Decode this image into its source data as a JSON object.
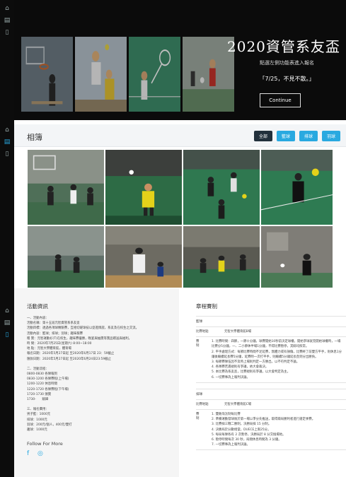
{
  "hero": {
    "title": "2020資管系友盃",
    "subtitle": "點選左側功能表進入報名",
    "date_text": "「7/25，不見不散。」",
    "continue_label": "Continue"
  },
  "gallery": {
    "title": "相簿",
    "filters": [
      {
        "label": "全部",
        "dark": true
      },
      {
        "label": "籃球",
        "dark": false
      },
      {
        "label": "排球",
        "dark": false
      },
      {
        "label": "羽球",
        "dark": false
      }
    ]
  },
  "info": {
    "heading": "活動資訊",
    "section1": [
      "一、活動內容：",
      "活動名稱：第十五屆元智資管系系友盃",
      "活動目標：透過各項球類競賽，互相切磋球技以促進情誼，系友及在校生之交流。",
      "活動內容：籃球；排球；羽球；趣味競賽",
      "贈 獎：元智運動衫(T)在校生，趣味賽優勝，晚宴與抽獎等獎品贈送與福利。",
      "時 間：2020年7月25日(星期六) 8:00~18:00",
      "地 點：元智大學體育館，體育場",
      "報名日期：2020年5月27日起 至2020年6月17日 23：59截止",
      "匯款日期：2020年5月27日起 至2020年6月24日23:59截止"
    ],
    "section2": [
      "二、活動流程：",
      "0800-0830 各隊報到",
      "0830-1200 各隊賽程(上午場)",
      "1200-1220 休息時間",
      "1220-1720 各隊賽程(下午場)",
      "1720-1730 頒獎",
      "1730-　　賦歸"
    ],
    "section3": [
      "三、報名費用：",
      "男子籃：1000元",
      "排球：1000元",
      "羽球：200元/個人，400元/雙打",
      "趣球：1000元"
    ],
    "follow_label": "Follow For More"
  },
  "rules": {
    "heading": "章程賽制",
    "basketball": {
      "title": "籃球",
      "venue_label": "比賽地點",
      "venue": "元智大學體育館B場",
      "rows": [
        {
          "k": "賽\n制",
          "v": "1. 比賽時間：四節，一節十分鐘，球賽開始10秒前決定球權，開始爭球就完開始球權時，一場比賽分5分鐘，一、二小節休半場1分鐘，不得比賽暫停，其餘均照常。\n2. 平手處理方式：每節比賽時間不足延賽，無體力或有損傷，比賽終了前雙方平手，則休息1分鐘後繼續延長賽5分鐘，延賽時一次打平手，則繼續5分鐘延長直到分出勝負。\n3. 每節賽隊伍因不及時上場則判定一方勝出，以不符判定不論。\n4. 各隊賽若遇規則有爭議，依大會裁決。\n5. 本比賽為系友盃，比賽規則有爭議，以大會判定為主。\n6. 一切賽事為上報判決論。"
        }
      ]
    },
    "volleyball": {
      "title": "排球",
      "venue_label": "比賽地點",
      "venue": "元智大學體育館C場",
      "rows": [
        {
          "k": "賽\n制",
          "v": "1. 雙敗淘汰制每比賽\n2. 準備運動發球後於第一場以爭分先推送，取得兩局勝利者進行搶定季賽。\n3. 比賽採三戰二勝制，決勝局採 15 分制。\n4. 決勝局於分數相當，DUECE上限25分。\n5. 每局每隊各有 2 次暫停，決勝局於 8 分交換場地。\n6. 暫停時間每次 30 秒，局間休息時間為 3 分鐘。\n7. 一切賽事為上報判決論。"
        }
      ]
    }
  }
}
